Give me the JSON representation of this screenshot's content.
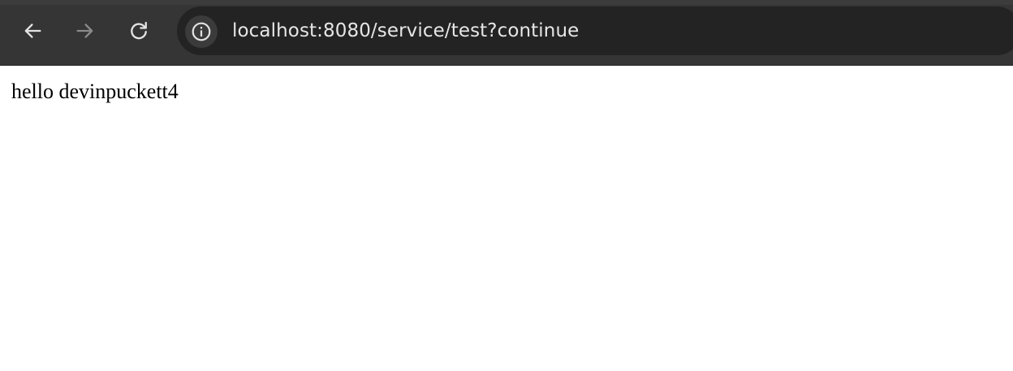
{
  "browser": {
    "url": "localhost:8080/service/test?continue",
    "icons": {
      "back": "arrow-left-icon",
      "forward": "arrow-right-icon",
      "reload": "reload-icon",
      "site_info": "info-icon"
    },
    "colors": {
      "toolbar": "#353535",
      "omnibox": "#232323",
      "url_text": "#e6e6e6",
      "forward_disabled": "#8a8a8a"
    }
  },
  "page": {
    "text": "hello devinpuckett4"
  }
}
